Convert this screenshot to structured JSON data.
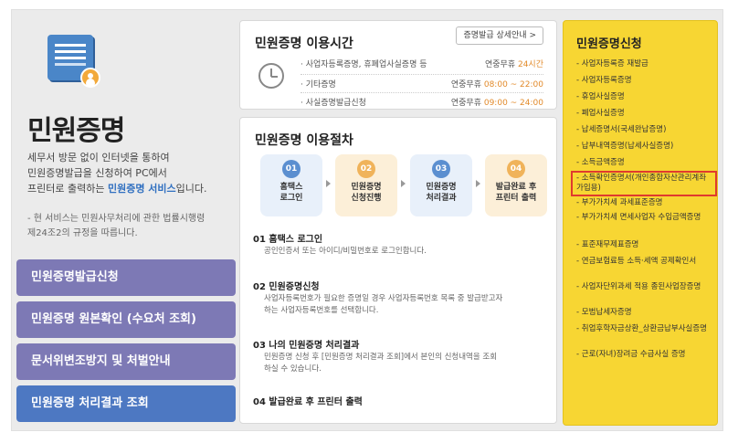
{
  "left": {
    "title": "민원증명",
    "desc_1": "세무서 방문 없이 인터넷을 통하여",
    "desc_2": "민원증명발급을 신청하여 PC에서",
    "desc_3_pre": "프린터로 출력하는 ",
    "desc_3_hl": "민원증명 서비스",
    "desc_3_post": "입니다.",
    "note_1": "- 현 서비스는 민원사무처리에 관한 법률시행령",
    "note_2": "제24조2의 규정을 따릅니다.",
    "buttons": [
      "민원증명발급신청",
      "민원증명 원본확인 (수요처 조회)",
      "문서위변조방지 및 처벌안내",
      "민원증명 처리결과 조회"
    ]
  },
  "hours": {
    "title": "민원증명 이용시간",
    "guide_btn": "증명발급 상세안내 >",
    "rows": [
      {
        "label": "· 사업자등록증명, 휴폐업사실증명 등",
        "prefix": "연중무휴 ",
        "value": "24시간"
      },
      {
        "label": "· 기타증명",
        "prefix": "연중무휴 ",
        "value": "08:00 ~ 22:00"
      },
      {
        "label": "· 사실증명발급신청",
        "prefix": "연중무휴 ",
        "value": "09:00 ~ 24:00"
      }
    ]
  },
  "procedure": {
    "title": "민원증명 이용절차",
    "steps": [
      {
        "num": "01",
        "line1": "홈택스",
        "line2": "로그인"
      },
      {
        "num": "02",
        "line1": "민원증명",
        "line2": "신청진행"
      },
      {
        "num": "03",
        "line1": "민원증명",
        "line2": "처리결과"
      },
      {
        "num": "04",
        "line1": "발급완료 후",
        "line2": "프린터 출력"
      }
    ],
    "details": [
      {
        "head": "01 홈택스 로그인",
        "d1": "공인인증서 또는 아이디/비밀번호로 로그인합니다.",
        "d2": ""
      },
      {
        "head": "02 민원증명신청",
        "d1": "사업자등록번호가 필요한 증명일 경우 사업자등록번호 목록 중 발급받고자",
        "d2": "하는 사업자등록번호를 선택합니다."
      },
      {
        "head": "03 나의 민원증명 처리결과",
        "d1": "민원증명 신청 후 [민원증명 처리결과 조회]에서 본인의 신청내역을 조회",
        "d2": "하실 수 있습니다."
      },
      {
        "head": "04 발급완료 후 프린터 출력",
        "d1": "",
        "d2": ""
      }
    ]
  },
  "right": {
    "title": "민원증명신청",
    "items": [
      "사업자등록증 재발급",
      "사업자등록증명",
      "휴업사실증명",
      "폐업사실증명",
      "납세증명서(국세완납증명)",
      "납부내역증명(납세사실증명)",
      "소득금액증명",
      "소득확인증명서(개인종합자산관리계좌 가입용)",
      "부가가치세 과세표준증명",
      "부가가치세 면세사업자 수입금액증명",
      "표준재무제표증명",
      "연금보험료등 소득·세액 공제확인서",
      "사업자단위과세 적용 종된사업장증명",
      "모범납세자증명",
      "취업후학자금상환_상환금납부사실증명",
      "근로(자녀)장려금 수급사실 증명"
    ]
  },
  "colors": {
    "accent_purple": "#7d79b5",
    "accent_blue": "#4d78c2",
    "right_panel": "#f7d633",
    "highlight_border": "#e03a2e",
    "time_orange": "#e28a2a"
  }
}
